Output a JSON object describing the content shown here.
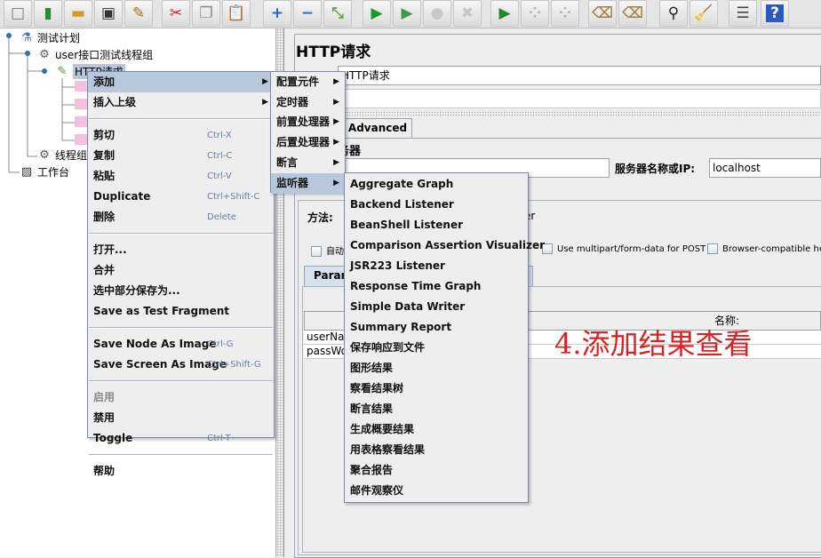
{
  "toolbar": {
    "buttons": [
      {
        "name": "new-icon",
        "glyph": "□",
        "color": "#777"
      },
      {
        "name": "templates-icon",
        "glyph": "▮",
        "color": "#2a8a3a"
      },
      {
        "name": "open-icon",
        "glyph": "▬",
        "color": "#d49a20"
      },
      {
        "name": "save-icon",
        "glyph": "▣",
        "color": "#333"
      },
      {
        "name": "save-as-icon",
        "glyph": "✎",
        "color": "#a07010"
      },
      {
        "name": "cut-icon",
        "glyph": "✂",
        "color": "#d02020"
      },
      {
        "name": "copy-icon",
        "glyph": "❐",
        "color": "#888"
      },
      {
        "name": "paste-icon",
        "glyph": "📋",
        "color": "#a07030"
      },
      {
        "name": "expand-icon",
        "glyph": "+",
        "color": "#2a6ad0"
      },
      {
        "name": "collapse-icon",
        "glyph": "−",
        "color": "#2a6ad0"
      },
      {
        "name": "toggle-icon",
        "glyph": "⤡",
        "color": "#6aa04a"
      },
      {
        "name": "start-icon",
        "glyph": "▶",
        "color": "#1a9a2a"
      },
      {
        "name": "start-no-pause-icon",
        "glyph": "▶",
        "color": "#3a9a4a"
      },
      {
        "name": "stop-icon",
        "glyph": "●",
        "color": "#c8c8c8"
      },
      {
        "name": "shutdown-icon",
        "glyph": "✖",
        "color": "#c8c8c8"
      },
      {
        "name": "remote-start-icon",
        "glyph": "▶",
        "color": "#1a8a2a"
      },
      {
        "name": "remote-stop-icon",
        "glyph": "⁘",
        "color": "#b0b0b0"
      },
      {
        "name": "remote-shutdown-icon",
        "glyph": "⁘",
        "color": "#b0b0b0"
      },
      {
        "name": "clear-icon",
        "glyph": "⌫",
        "color": "#a08040"
      },
      {
        "name": "clear-all-icon",
        "glyph": "⌫",
        "color": "#a08040"
      },
      {
        "name": "search-icon",
        "glyph": "⚲",
        "color": "#222"
      },
      {
        "name": "reset-search-icon",
        "glyph": "🧹",
        "color": "#c09020"
      },
      {
        "name": "function-helper-icon",
        "glyph": "☰",
        "color": "#444"
      },
      {
        "name": "help-icon",
        "glyph": "?",
        "color": "#fff"
      }
    ]
  },
  "tree": {
    "plan": "测试计划",
    "thread_group": "user接口测试线程组",
    "http_request": "HTTP请求",
    "thread_group2": "线程组",
    "workbench": "工作台"
  },
  "panel": {
    "title": "HTTP请求",
    "name_value": "HTTP请求",
    "tab_advanced": "Advanced",
    "server_section_fragment": "务器",
    "server_label": "服务器名称或IP:",
    "server_value": "localhost",
    "method_label": "方法:",
    "method_fragment": "er",
    "auto_fragment": "自动",
    "multipart_label": "Use multipart/form-data for POST",
    "browser_label": "Browser-compatible hea",
    "params_tab_fragment": "Paran",
    "name_header": "名称:",
    "rows": [
      "userNa",
      "passWo"
    ]
  },
  "annotation": {
    "text": "4.添加结果查看",
    "color": "#e02020"
  },
  "context_menu": {
    "items": [
      {
        "label": "添加",
        "submenu": true,
        "selected": true
      },
      {
        "label": "插入上级",
        "submenu": true
      },
      {
        "sep": true
      },
      {
        "label": "剪切",
        "shortcut": "Ctrl-X"
      },
      {
        "label": "复制",
        "shortcut": "Ctrl-C"
      },
      {
        "label": "粘贴",
        "shortcut": "Ctrl-V"
      },
      {
        "label": "Duplicate",
        "shortcut": "Ctrl+Shift-C"
      },
      {
        "label": "删除",
        "shortcut": "Delete"
      },
      {
        "sep": true
      },
      {
        "label": "打开..."
      },
      {
        "label": "合并"
      },
      {
        "label": "选中部分保存为..."
      },
      {
        "label": "Save as Test Fragment"
      },
      {
        "sep": true
      },
      {
        "label": "Save Node As Image",
        "shortcut": "Ctrl-G"
      },
      {
        "label": "Save Screen As Image",
        "shortcut": "Ctrl+Shift-G"
      },
      {
        "sep": true
      },
      {
        "label": "启用",
        "disabled": true
      },
      {
        "label": "禁用"
      },
      {
        "label": "Toggle",
        "shortcut": "Ctrl-T"
      },
      {
        "sep": true
      },
      {
        "label": "帮助"
      }
    ]
  },
  "add_submenu": {
    "items": [
      {
        "label": "配置元件"
      },
      {
        "label": "定时器"
      },
      {
        "label": "前置处理器"
      },
      {
        "label": "后置处理器"
      },
      {
        "label": "断言"
      },
      {
        "label": "监听器",
        "selected": true
      }
    ]
  },
  "listener_submenu": {
    "items": [
      "Aggregate Graph",
      "Backend Listener",
      "BeanShell Listener",
      "Comparison Assertion Visualizer",
      "JSR223 Listener",
      "Response Time Graph",
      "Simple Data Writer",
      "Summary Report",
      "保存响应到文件",
      "图形结果",
      "察看结果树",
      "断言结果",
      "生成概要结果",
      "用表格察看结果",
      "聚合报告",
      "邮件观察仪"
    ]
  }
}
